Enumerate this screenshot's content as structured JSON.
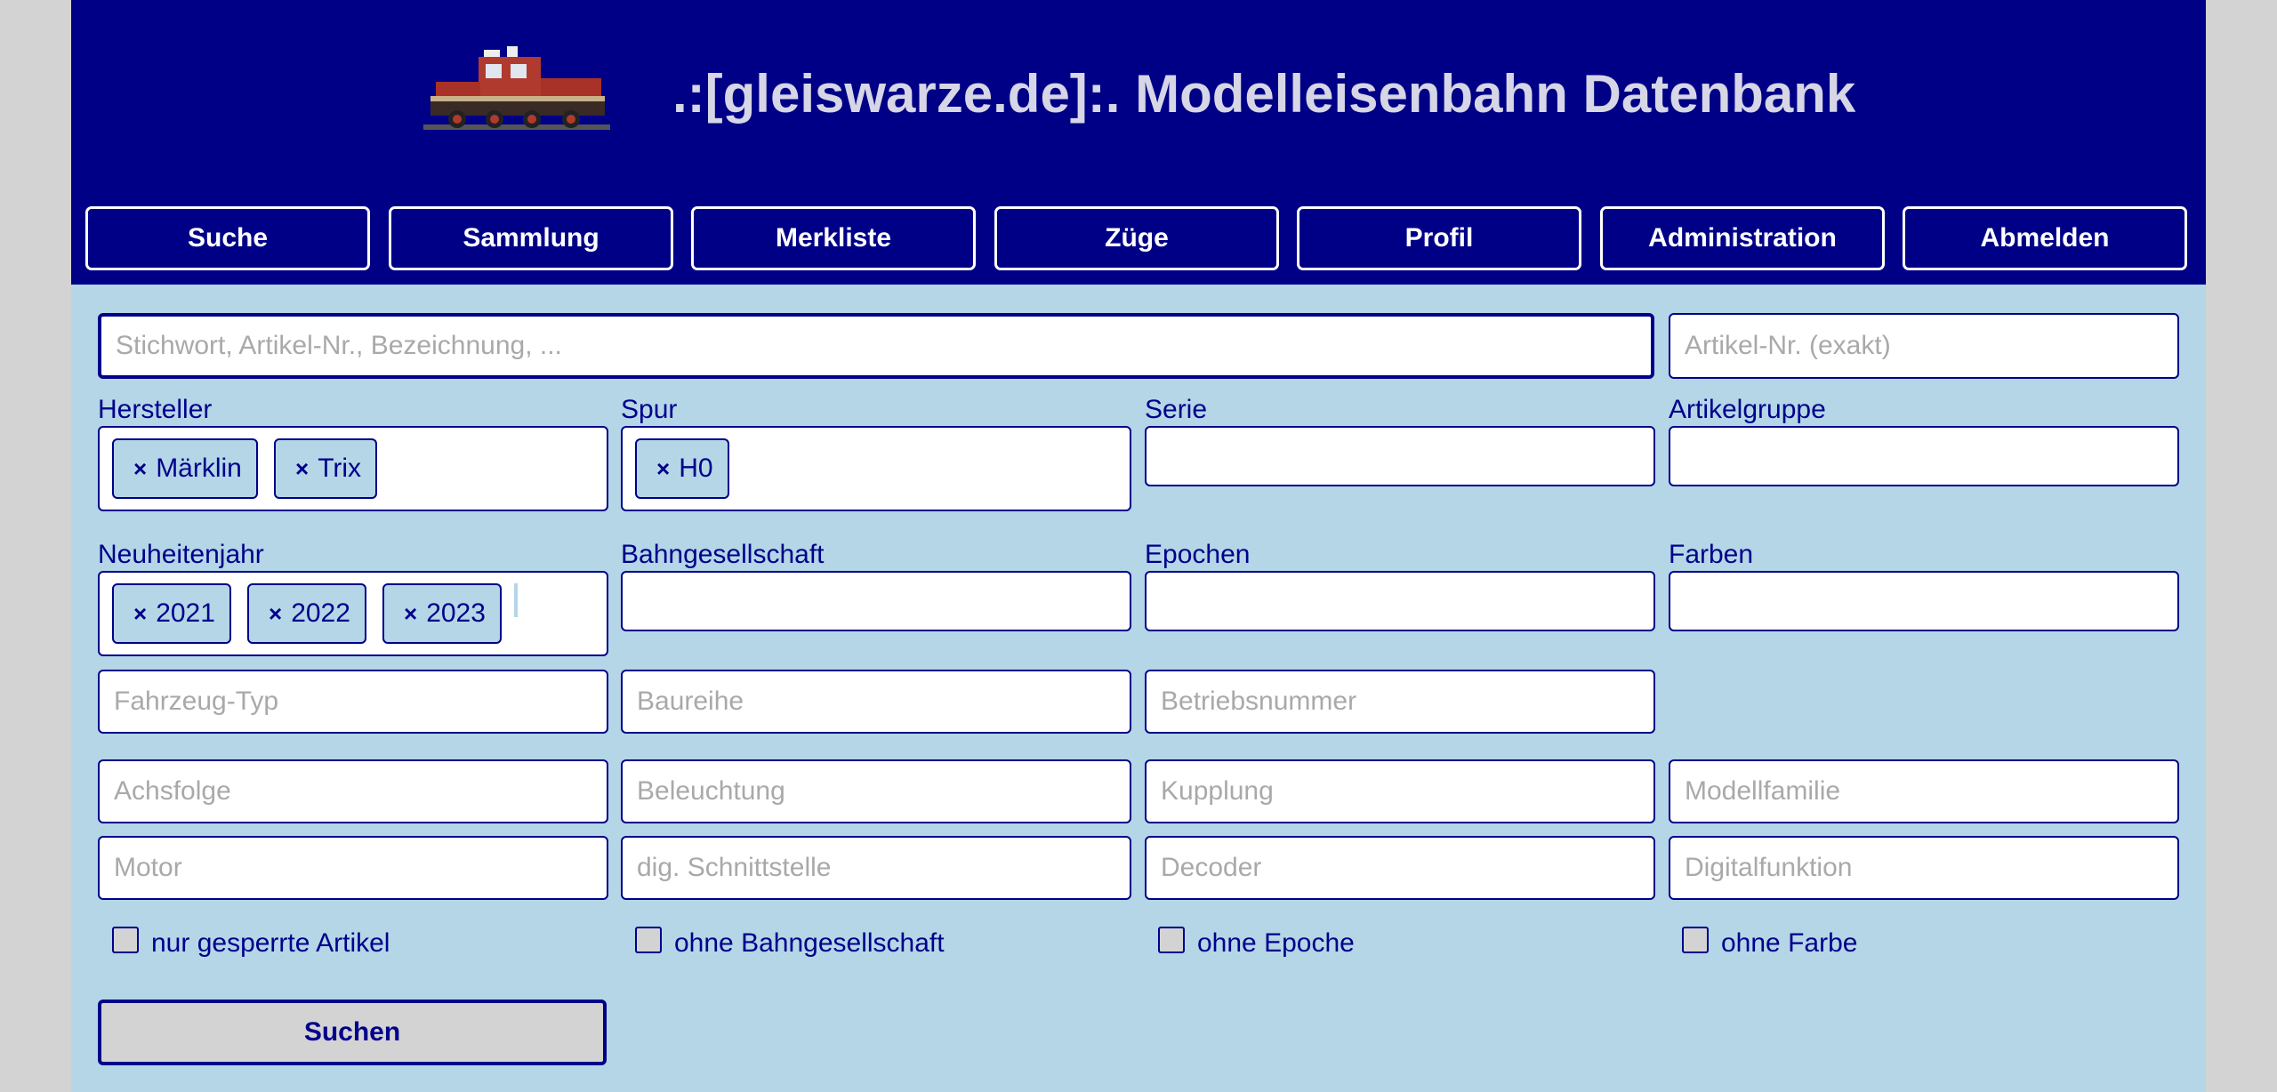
{
  "header": {
    "title": ".:[gleiswarze.de]:. Modelleisenbahn Datenbank",
    "logo_icon": "locomotive-icon"
  },
  "nav": [
    "Suche",
    "Sammlung",
    "Merkliste",
    "Züge",
    "Profil",
    "Administration",
    "Abmelden"
  ],
  "search": {
    "keyword_placeholder": "Stichwort, Artikel-Nr., Bezeichnung, ...",
    "article_no_placeholder": "Artikel-Nr. (exakt)"
  },
  "filters": {
    "hersteller": {
      "label": "Hersteller",
      "tags": [
        "Märklin",
        "Trix"
      ]
    },
    "spur": {
      "label": "Spur",
      "tags": [
        "H0"
      ]
    },
    "serie": {
      "label": "Serie"
    },
    "artikelgruppe": {
      "label": "Artikelgruppe"
    },
    "neuheitenjahr": {
      "label": "Neuheitenjahr",
      "tags": [
        "2021",
        "2022",
        "2023"
      ]
    },
    "bahngesellschaft": {
      "label": "Bahngesellschaft"
    },
    "epochen": {
      "label": "Epochen"
    },
    "farben": {
      "label": "Farben"
    }
  },
  "tag_remove_symbol": "×",
  "placeholders": {
    "fahrzeug_typ": "Fahrzeug-Typ",
    "baureihe": "Baureihe",
    "betriebsnummer": "Betriebsnummer",
    "achsfolge": "Achsfolge",
    "beleuchtung": "Beleuchtung",
    "kupplung": "Kupplung",
    "modellfamilie": "Modellfamilie",
    "motor": "Motor",
    "schnittstelle": "dig. Schnittstelle",
    "decoder": "Decoder",
    "digitalfunktion": "Digitalfunktion"
  },
  "checkboxes": {
    "gesperrt": "nur gesperrte Artikel",
    "ohne_bahngesellschaft": "ohne Bahngesellschaft",
    "ohne_epoche": "ohne Epoche",
    "ohne_farbe": "ohne Farbe"
  },
  "submit_label": "Suchen",
  "colors": {
    "header_bg": "#000087",
    "page_bg": "#b4d6e7",
    "accent": "#00008b"
  }
}
